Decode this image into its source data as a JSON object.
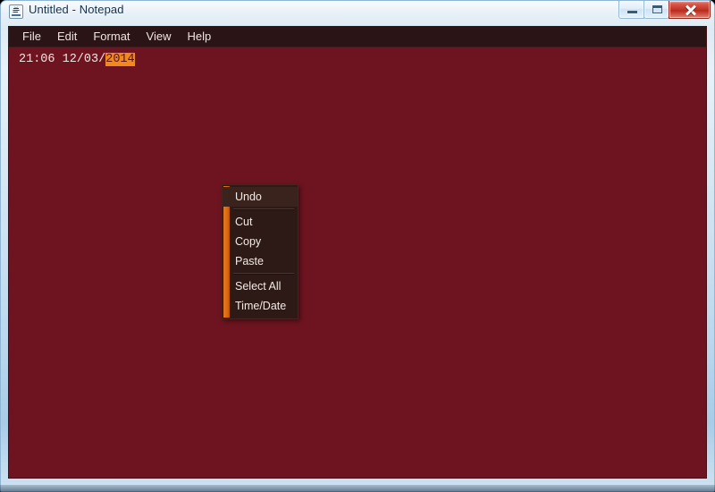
{
  "window": {
    "title": "Untitled - Notepad",
    "icon": "notepad-icon",
    "controls": {
      "minimize_label": "Minimize",
      "maximize_label": "Maximize",
      "close_label": "Close"
    }
  },
  "menubar": {
    "items": [
      {
        "label": "File"
      },
      {
        "label": "Edit"
      },
      {
        "label": "Format"
      },
      {
        "label": "View"
      },
      {
        "label": "Help"
      }
    ]
  },
  "document": {
    "text_before_selection": "21:06 12/03/",
    "selected_text": "2014",
    "full_text": "21:06 12/03/2014"
  },
  "context_menu": {
    "items": [
      {
        "label": "Undo",
        "separator_after": true
      },
      {
        "label": "Cut",
        "separator_after": false
      },
      {
        "label": "Copy",
        "separator_after": false
      },
      {
        "label": "Paste",
        "separator_after": true
      },
      {
        "label": "Select All",
        "separator_after": false
      },
      {
        "label": "Time/Date",
        "separator_after": false
      }
    ]
  },
  "colors": {
    "client_background": "#6e1420",
    "menubar_background": "#2a1416",
    "context_menu_background": "#2d1a17",
    "accent_orange": "#e8781a",
    "selection_background": "#f08a1c",
    "text_color": "#f2e7e4",
    "close_button": "#c03325"
  }
}
